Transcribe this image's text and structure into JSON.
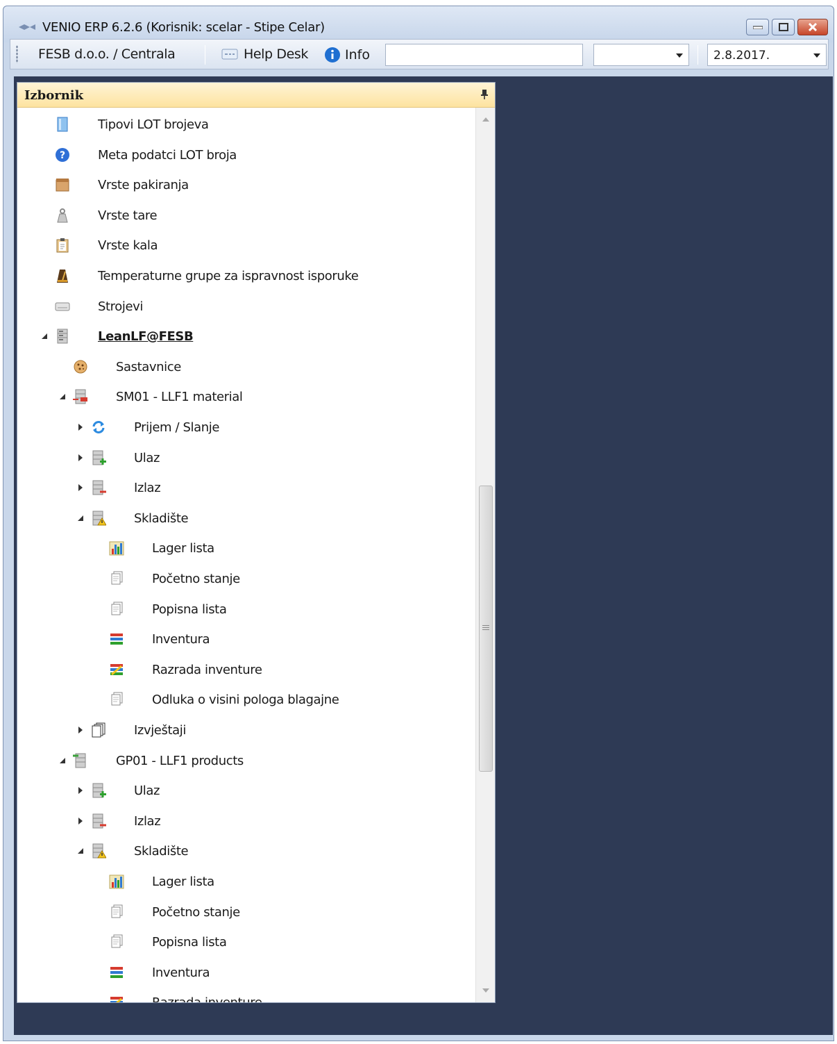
{
  "window": {
    "title": "VENIO ERP 6.2.6 (Korisnik: scelar - Stipe Celar)"
  },
  "toolbar": {
    "company": "FESB d.o.o. / Centrala",
    "helpdesk_label": "Help Desk",
    "info_label": "Info",
    "search_value": "",
    "select_value": "",
    "date_value": "2.8.2017."
  },
  "panel": {
    "title": "Izbornik"
  },
  "tree": [
    {
      "label": "Tipovi LOT brojeva",
      "icon": "document-icon",
      "level": 0,
      "expander": "none"
    },
    {
      "label": "Meta podatci LOT broja",
      "icon": "help-icon",
      "level": 0,
      "expander": "none"
    },
    {
      "label": "Vrste pakiranja",
      "icon": "package-icon",
      "level": 0,
      "expander": "none"
    },
    {
      "label": "Vrste tare",
      "icon": "weight-icon",
      "level": 0,
      "expander": "none"
    },
    {
      "label": "Vrste kala",
      "icon": "clipboard-icon",
      "level": 0,
      "expander": "none"
    },
    {
      "label": "Temperaturne grupe za ispravnost isporuke",
      "icon": "metronome-icon",
      "level": 0,
      "expander": "none"
    },
    {
      "label": "Strojevi",
      "icon": "keyboard-icon",
      "level": 0,
      "expander": "none"
    },
    {
      "label": "LeanLF@FESB",
      "icon": "server-icon",
      "level": 0,
      "expander": "open",
      "link": true
    },
    {
      "label": "Sastavnice",
      "icon": "cookie-icon",
      "level": 1,
      "expander": "none"
    },
    {
      "label": "SM01 - LLF1 material",
      "icon": "server-out-icon",
      "level": 1,
      "expander": "open"
    },
    {
      "label": "Prijem / Slanje",
      "icon": "sync-icon",
      "level": 2,
      "expander": "closed"
    },
    {
      "label": "Ulaz",
      "icon": "server-add-icon",
      "level": 2,
      "expander": "closed"
    },
    {
      "label": "Izlaz",
      "icon": "server-remove-icon",
      "level": 2,
      "expander": "closed"
    },
    {
      "label": "Skladište",
      "icon": "server-warning-icon",
      "level": 2,
      "expander": "open"
    },
    {
      "label": "Lager lista",
      "icon": "bar-chart-icon",
      "level": 3,
      "expander": "none"
    },
    {
      "label": "Početno stanje",
      "icon": "pages-icon",
      "level": 3,
      "expander": "none"
    },
    {
      "label": "Popisna lista",
      "icon": "pages-icon",
      "level": 3,
      "expander": "none"
    },
    {
      "label": "Inventura",
      "icon": "stack-icon",
      "level": 3,
      "expander": "none"
    },
    {
      "label": "Razrada inventure",
      "icon": "stack-edit-icon",
      "level": 3,
      "expander": "none"
    },
    {
      "label": "Odluka o visini pologa blagajne",
      "icon": "pages-icon",
      "level": 3,
      "expander": "none"
    },
    {
      "label": "Izvještaji",
      "icon": "reports-icon",
      "level": 2,
      "expander": "closed"
    },
    {
      "label": "GP01 - LLF1 products",
      "icon": "server-in-icon",
      "level": 1,
      "expander": "open"
    },
    {
      "label": "Ulaz",
      "icon": "server-add-icon",
      "level": 2,
      "expander": "closed"
    },
    {
      "label": "Izlaz",
      "icon": "server-remove-icon",
      "level": 2,
      "expander": "closed"
    },
    {
      "label": "Skladište",
      "icon": "server-warning-icon",
      "level": 2,
      "expander": "open"
    },
    {
      "label": "Lager lista",
      "icon": "bar-chart-icon",
      "level": 3,
      "expander": "none"
    },
    {
      "label": "Početno stanje",
      "icon": "pages-icon",
      "level": 3,
      "expander": "none"
    },
    {
      "label": "Popisna lista",
      "icon": "pages-icon",
      "level": 3,
      "expander": "none"
    },
    {
      "label": "Inventura",
      "icon": "stack-icon",
      "level": 3,
      "expander": "none"
    },
    {
      "label": "Razrada inventure",
      "icon": "stack-edit-icon",
      "level": 3,
      "expander": "none"
    }
  ]
}
